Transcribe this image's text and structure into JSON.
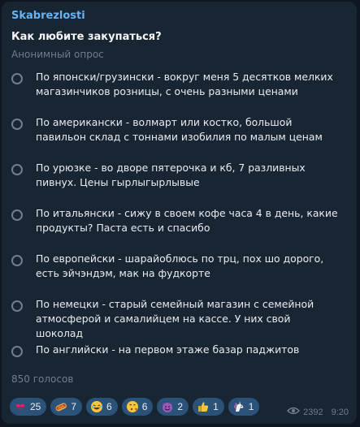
{
  "message": {
    "author": "Skabrezlosti",
    "question": "Как любите закупаться?",
    "poll_type": "Анонимный опрос",
    "options": [
      {
        "text": "По японски/грузински - вокруг меня 5 десятков мелких магазинчиков розницы, с очень разными ценами"
      },
      {
        "text": "По американски - волмарт или костко, большой павильон склад с тоннами изобилия по малым ценам"
      },
      {
        "text": "По урюзке - во дворе пятерочка и кб, 7 разливных пивнух. Цены гырлыгырлывые"
      },
      {
        "text": "По итальянски - сижу в своем кофе часа 4 в день, какие продукты? Паста есть и спасибо"
      },
      {
        "text": "По европейски - шарайоблюсь по трц, пох шо дорого, есть эйчэндэм, мак на фудкорте"
      },
      {
        "text": "По немецки - старый семейный магазин с семейной атмосферой и самалийцем на кассе. У них свой шоколад"
      },
      {
        "text": "По английски - на первом этаже базар паджитов"
      }
    ],
    "votes": "850 голосов",
    "reactions": [
      {
        "icon": "kiss-mark-icon",
        "count": "25"
      },
      {
        "icon": "hotdog-icon",
        "count": "7"
      },
      {
        "icon": "rofl-icon",
        "count": "6"
      },
      {
        "icon": "face-blowing-kiss-icon",
        "count": "6"
      },
      {
        "icon": "smiling-devil-icon",
        "count": "2"
      },
      {
        "icon": "thumbs-up-icon",
        "count": "1"
      },
      {
        "icon": "unicorn-icon",
        "count": "1"
      }
    ],
    "views": "2392",
    "time": "9:20"
  },
  "colors": {
    "background": "#0e1621",
    "bubble": "#182533",
    "author": "#6ab3f3",
    "reaction_chip": "#2b5278",
    "muted": "#6d7f8f"
  }
}
